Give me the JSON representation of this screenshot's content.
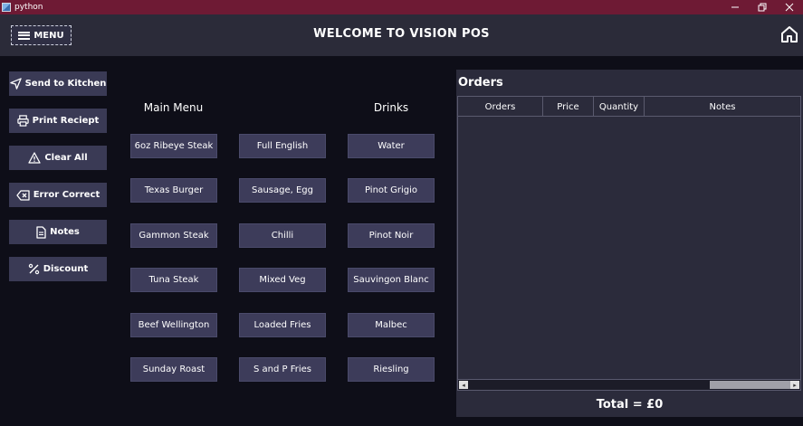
{
  "window": {
    "title": "python"
  },
  "header": {
    "menu_label": "MENU",
    "title": "WELCOME TO VISION POS"
  },
  "actions": [
    {
      "label": "Send to Kitchen",
      "icon": "send-icon"
    },
    {
      "label": "Print Reciept",
      "icon": "printer-icon"
    },
    {
      "label": "Clear All",
      "icon": "warning-icon"
    },
    {
      "label": "Error Correct",
      "icon": "backspace-icon"
    },
    {
      "label": "Notes",
      "icon": "document-icon"
    },
    {
      "label": "Discount",
      "icon": "percent-icon"
    }
  ],
  "menu": {
    "main_heading": "Main Menu",
    "drinks_heading": "Drinks",
    "col1": [
      "6oz Ribeye Steak",
      "Texas Burger",
      "Gammon Steak",
      "Tuna Steak",
      "Beef Wellington",
      "Sunday Roast"
    ],
    "col2": [
      "Full English",
      "Sausage, Egg",
      "Chilli",
      "Mixed Veg",
      "Loaded Fries",
      "S and P Fries"
    ],
    "col3": [
      "Water",
      "Pinot Grigio",
      "Pinot Noir",
      "Sauvingon Blanc",
      "Malbec",
      "Riesling"
    ]
  },
  "orders": {
    "title": "Orders",
    "columns": [
      "Orders",
      "Price",
      "Quantity",
      "Notes"
    ],
    "total": "Total = £0"
  },
  "colors": {
    "titlebar": "#6e1a34",
    "background": "#0e0e18",
    "panel": "#2b2b39",
    "button": "#3d3c5a"
  }
}
